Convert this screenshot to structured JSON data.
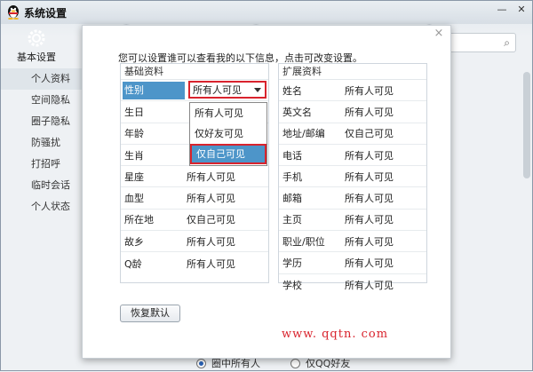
{
  "window": {
    "title": "系统设置",
    "min_glyph": "—",
    "close_glyph": "✕"
  },
  "sidebar": {
    "heading": "基本设置",
    "items": [
      {
        "label": "个人资料",
        "active": true
      },
      {
        "label": "空间隐私"
      },
      {
        "label": "圈子隐私"
      },
      {
        "label": "防骚扰"
      },
      {
        "label": "打招呼"
      },
      {
        "label": "临时会话"
      },
      {
        "label": "个人状态"
      }
    ]
  },
  "search": {
    "icon": "search-icon"
  },
  "background_radios": [
    {
      "label": "圈中所有人",
      "checked": true
    },
    {
      "label": "仅QQ好友",
      "checked": false
    }
  ],
  "dialog": {
    "close_glyph": "×",
    "intro": "您可以设置谁可以查看我的以下信息，点击可改变设置。",
    "basic": {
      "title": "基础资料",
      "rows": [
        {
          "label": "性别",
          "value": "所有人可见"
        },
        {
          "label": "生日",
          "value": ""
        },
        {
          "label": "年龄",
          "value": ""
        },
        {
          "label": "生肖",
          "value": ""
        },
        {
          "label": "星座",
          "value": "所有人可见"
        },
        {
          "label": "血型",
          "value": "所有人可见"
        },
        {
          "label": "所在地",
          "value": "仅自己可见"
        },
        {
          "label": "故乡",
          "value": "所有人可见"
        },
        {
          "label": "Q龄",
          "value": "所有人可见"
        }
      ]
    },
    "extended": {
      "title": "扩展资料",
      "rows": [
        {
          "label": "姓名",
          "value": "所有人可见"
        },
        {
          "label": "英文名",
          "value": "所有人可见"
        },
        {
          "label": "地址/邮编",
          "value": "仅自己可见"
        },
        {
          "label": "电话",
          "value": "所有人可见"
        },
        {
          "label": "手机",
          "value": "所有人可见"
        },
        {
          "label": "邮箱",
          "value": "所有人可见"
        },
        {
          "label": "主页",
          "value": "所有人可见"
        },
        {
          "label": "职业/职位",
          "value": "所有人可见"
        },
        {
          "label": "学历",
          "value": "所有人可见"
        },
        {
          "label": "学校",
          "value": "所有人可见"
        }
      ]
    },
    "dropdown": {
      "selected": "所有人可见",
      "options": [
        "所有人可见",
        "仅好友可见",
        "仅自己可见"
      ],
      "highlighted": "仅自己可见"
    },
    "reset_label": "恢复默认",
    "watermark": "www. qqtn. com"
  },
  "colors": {
    "selection": "#4d95c9",
    "highlight_border": "#d9232d",
    "watermark": "#d9232d"
  }
}
